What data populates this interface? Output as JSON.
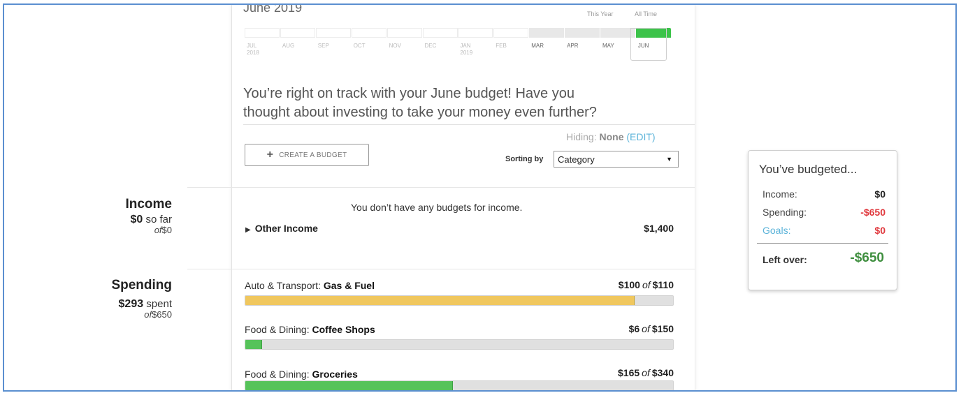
{
  "header": {
    "month_title": "June 2019",
    "range_links": [
      "This Year",
      "All Time"
    ]
  },
  "timeline": {
    "months": [
      {
        "label": "JUL",
        "year": "2018",
        "has_budget": false
      },
      {
        "label": "AUG",
        "year": "",
        "has_budget": false
      },
      {
        "label": "SEP",
        "year": "",
        "has_budget": false
      },
      {
        "label": "OCT",
        "year": "",
        "has_budget": false
      },
      {
        "label": "NOV",
        "year": "",
        "has_budget": false
      },
      {
        "label": "DEC",
        "year": "",
        "has_budget": false
      },
      {
        "label": "JAN",
        "year": "2019",
        "has_budget": false
      },
      {
        "label": "FEB",
        "year": "",
        "has_budget": false
      },
      {
        "label": "MAR",
        "year": "",
        "has_budget": true
      },
      {
        "label": "APR",
        "year": "",
        "has_budget": true
      },
      {
        "label": "MAY",
        "year": "",
        "has_budget": true
      },
      {
        "label": "JUN",
        "year": "",
        "has_budget": true,
        "current": true
      }
    ]
  },
  "message": {
    "line1": "You’re right on track with your June budget! Have you",
    "line2": "thought about investing to take your money even further?"
  },
  "controls": {
    "hiding_label": "Hiding:",
    "hiding_value": "None",
    "edit_label": "(EDIT)",
    "create_plus": "+",
    "create_label": "CREATE A BUDGET",
    "sorting_label": "Sorting by",
    "sort_value": "Category"
  },
  "income": {
    "title": "Income",
    "amount": "$0",
    "amount_suffix": "so far",
    "of_word": "of",
    "of_amount": "$0",
    "empty_message": "You don’t have any budgets for income.",
    "other_income_label": "Other Income",
    "other_income_amount": "$1,400"
  },
  "spending": {
    "title": "Spending",
    "amount": "$293",
    "amount_suffix": "spent",
    "of_word": "of",
    "of_amount": "$650",
    "budgets": [
      {
        "category": "Auto & Transport:",
        "subcategory": "Gas & Fuel",
        "spent": "$100",
        "of_word": "of",
        "budget": "$110",
        "progress": 0.91,
        "color": "#f0c75e"
      },
      {
        "category": "Food & Dining:",
        "subcategory": "Coffee Shops",
        "spent": "$6",
        "of_word": "of",
        "budget": "$150",
        "progress": 0.04,
        "color": "#56c35a"
      },
      {
        "category": "Food & Dining:",
        "subcategory": "Groceries",
        "spent": "$165",
        "of_word": "of",
        "budget": "$340",
        "progress": 0.485,
        "color": "#56c35a"
      }
    ]
  },
  "summary": {
    "title": "You’ve budgeted...",
    "rows": [
      {
        "label": "Income:",
        "value": "$0",
        "value_color": "#222222",
        "label_color": "#444444"
      },
      {
        "label": "Spending:",
        "value": "-$650",
        "value_color": "#e0393e",
        "label_color": "#444444"
      },
      {
        "label": "Goals:",
        "value": "$0",
        "value_color": "#e0393e",
        "label_color": "#5bb3d9"
      }
    ],
    "left_over_label": "Left over:",
    "left_over_value": "-$650",
    "left_over_color": "#3f8f3f"
  },
  "colors": {
    "current_month": "#3cc34a",
    "link": "#5bb3d9",
    "frame": "#5b8fd0"
  }
}
